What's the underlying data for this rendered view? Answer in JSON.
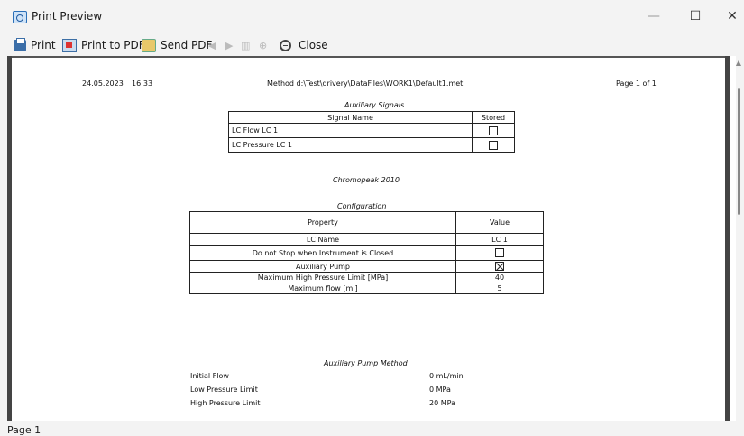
{
  "window": {
    "title": "Print Preview",
    "minimize": "—",
    "maximize": "☐",
    "close": "✕"
  },
  "toolbar": {
    "print": "Print",
    "print_to_pdf": "Print to PDF",
    "send_pdf": "Send PDF",
    "close": "Close"
  },
  "header": {
    "date": "24.05.2023",
    "time": "16:33",
    "method": "Method d:\\Test\\drivery\\DataFiles\\WORK1\\Default1.met",
    "page": "Page 1 of 1"
  },
  "aux_signals": {
    "title": "Auxiliary Signals",
    "col_name": "Signal Name",
    "col_stored": "Stored",
    "rows": [
      {
        "name": "LC Flow LC 1",
        "stored": false
      },
      {
        "name": "LC Pressure LC 1",
        "stored": false
      }
    ]
  },
  "chromopeak": "Chromopeak 2010",
  "configuration": {
    "title": "Configuration",
    "col_property": "Property",
    "col_value": "Value",
    "rows": [
      {
        "property": "LC Name",
        "value": "LC 1"
      },
      {
        "property": "Do not Stop when Instrument is Closed",
        "value": "",
        "checkbox": "unchecked"
      },
      {
        "property": "Auxiliary Pump",
        "value": "",
        "checkbox": "checked"
      },
      {
        "property": "Maximum High Pressure Limit [MPa]",
        "value": "40"
      },
      {
        "property": "Maximum flow [ml]",
        "value": "5"
      }
    ]
  },
  "aux_pump": {
    "title": "Auxiliary Pump Method",
    "rows": [
      {
        "label": "Initial Flow",
        "value": "0 mL/min"
      },
      {
        "label": "Low Pressure Limit",
        "value": "0 MPa"
      },
      {
        "label": "High Pressure Limit",
        "value": "20 MPa"
      }
    ]
  },
  "status": {
    "text": "Page 1"
  }
}
